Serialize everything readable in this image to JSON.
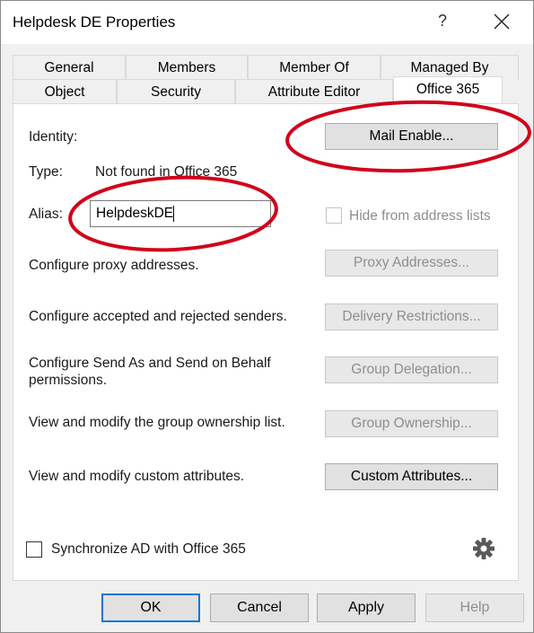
{
  "window": {
    "title": "Helpdesk DE Properties",
    "help_glyph": "?",
    "close_icon": "close-icon"
  },
  "tabs_row1": [
    {
      "label": "General"
    },
    {
      "label": "Members"
    },
    {
      "label": "Member Of"
    },
    {
      "label": "Managed By"
    }
  ],
  "tabs_row2": [
    {
      "label": "Object"
    },
    {
      "label": "Security"
    },
    {
      "label": "Attribute Editor"
    },
    {
      "label": "Office 365",
      "active": true
    }
  ],
  "panel": {
    "identity_label": "Identity:",
    "mail_enable_button": "Mail Enable...",
    "type_label": "Type:",
    "type_value": "Not found in Office 365",
    "alias_label": "Alias:",
    "alias_value": "HelpdeskDE",
    "hide_checkbox_label": "Hide from address lists",
    "proxy_text": "Configure proxy addresses.",
    "proxy_button": "Proxy Addresses...",
    "senders_text": "Configure accepted and rejected senders.",
    "senders_button": "Delivery Restrictions...",
    "sendas_text_line1": "Configure Send As and Send on Behalf",
    "sendas_text_line2": "permissions.",
    "sendas_button": "Group Delegation...",
    "ownership_text": "View and modify the group ownership list.",
    "ownership_button": "Group Ownership...",
    "custom_text": "View and modify custom attributes.",
    "custom_button": "Custom Attributes...",
    "sync_label": "Synchronize AD with Office 365",
    "settings_icon": "gear-icon"
  },
  "footer": {
    "ok": "OK",
    "cancel": "Cancel",
    "apply": "Apply",
    "help": "Help"
  },
  "annotation_color": "#d0021b"
}
